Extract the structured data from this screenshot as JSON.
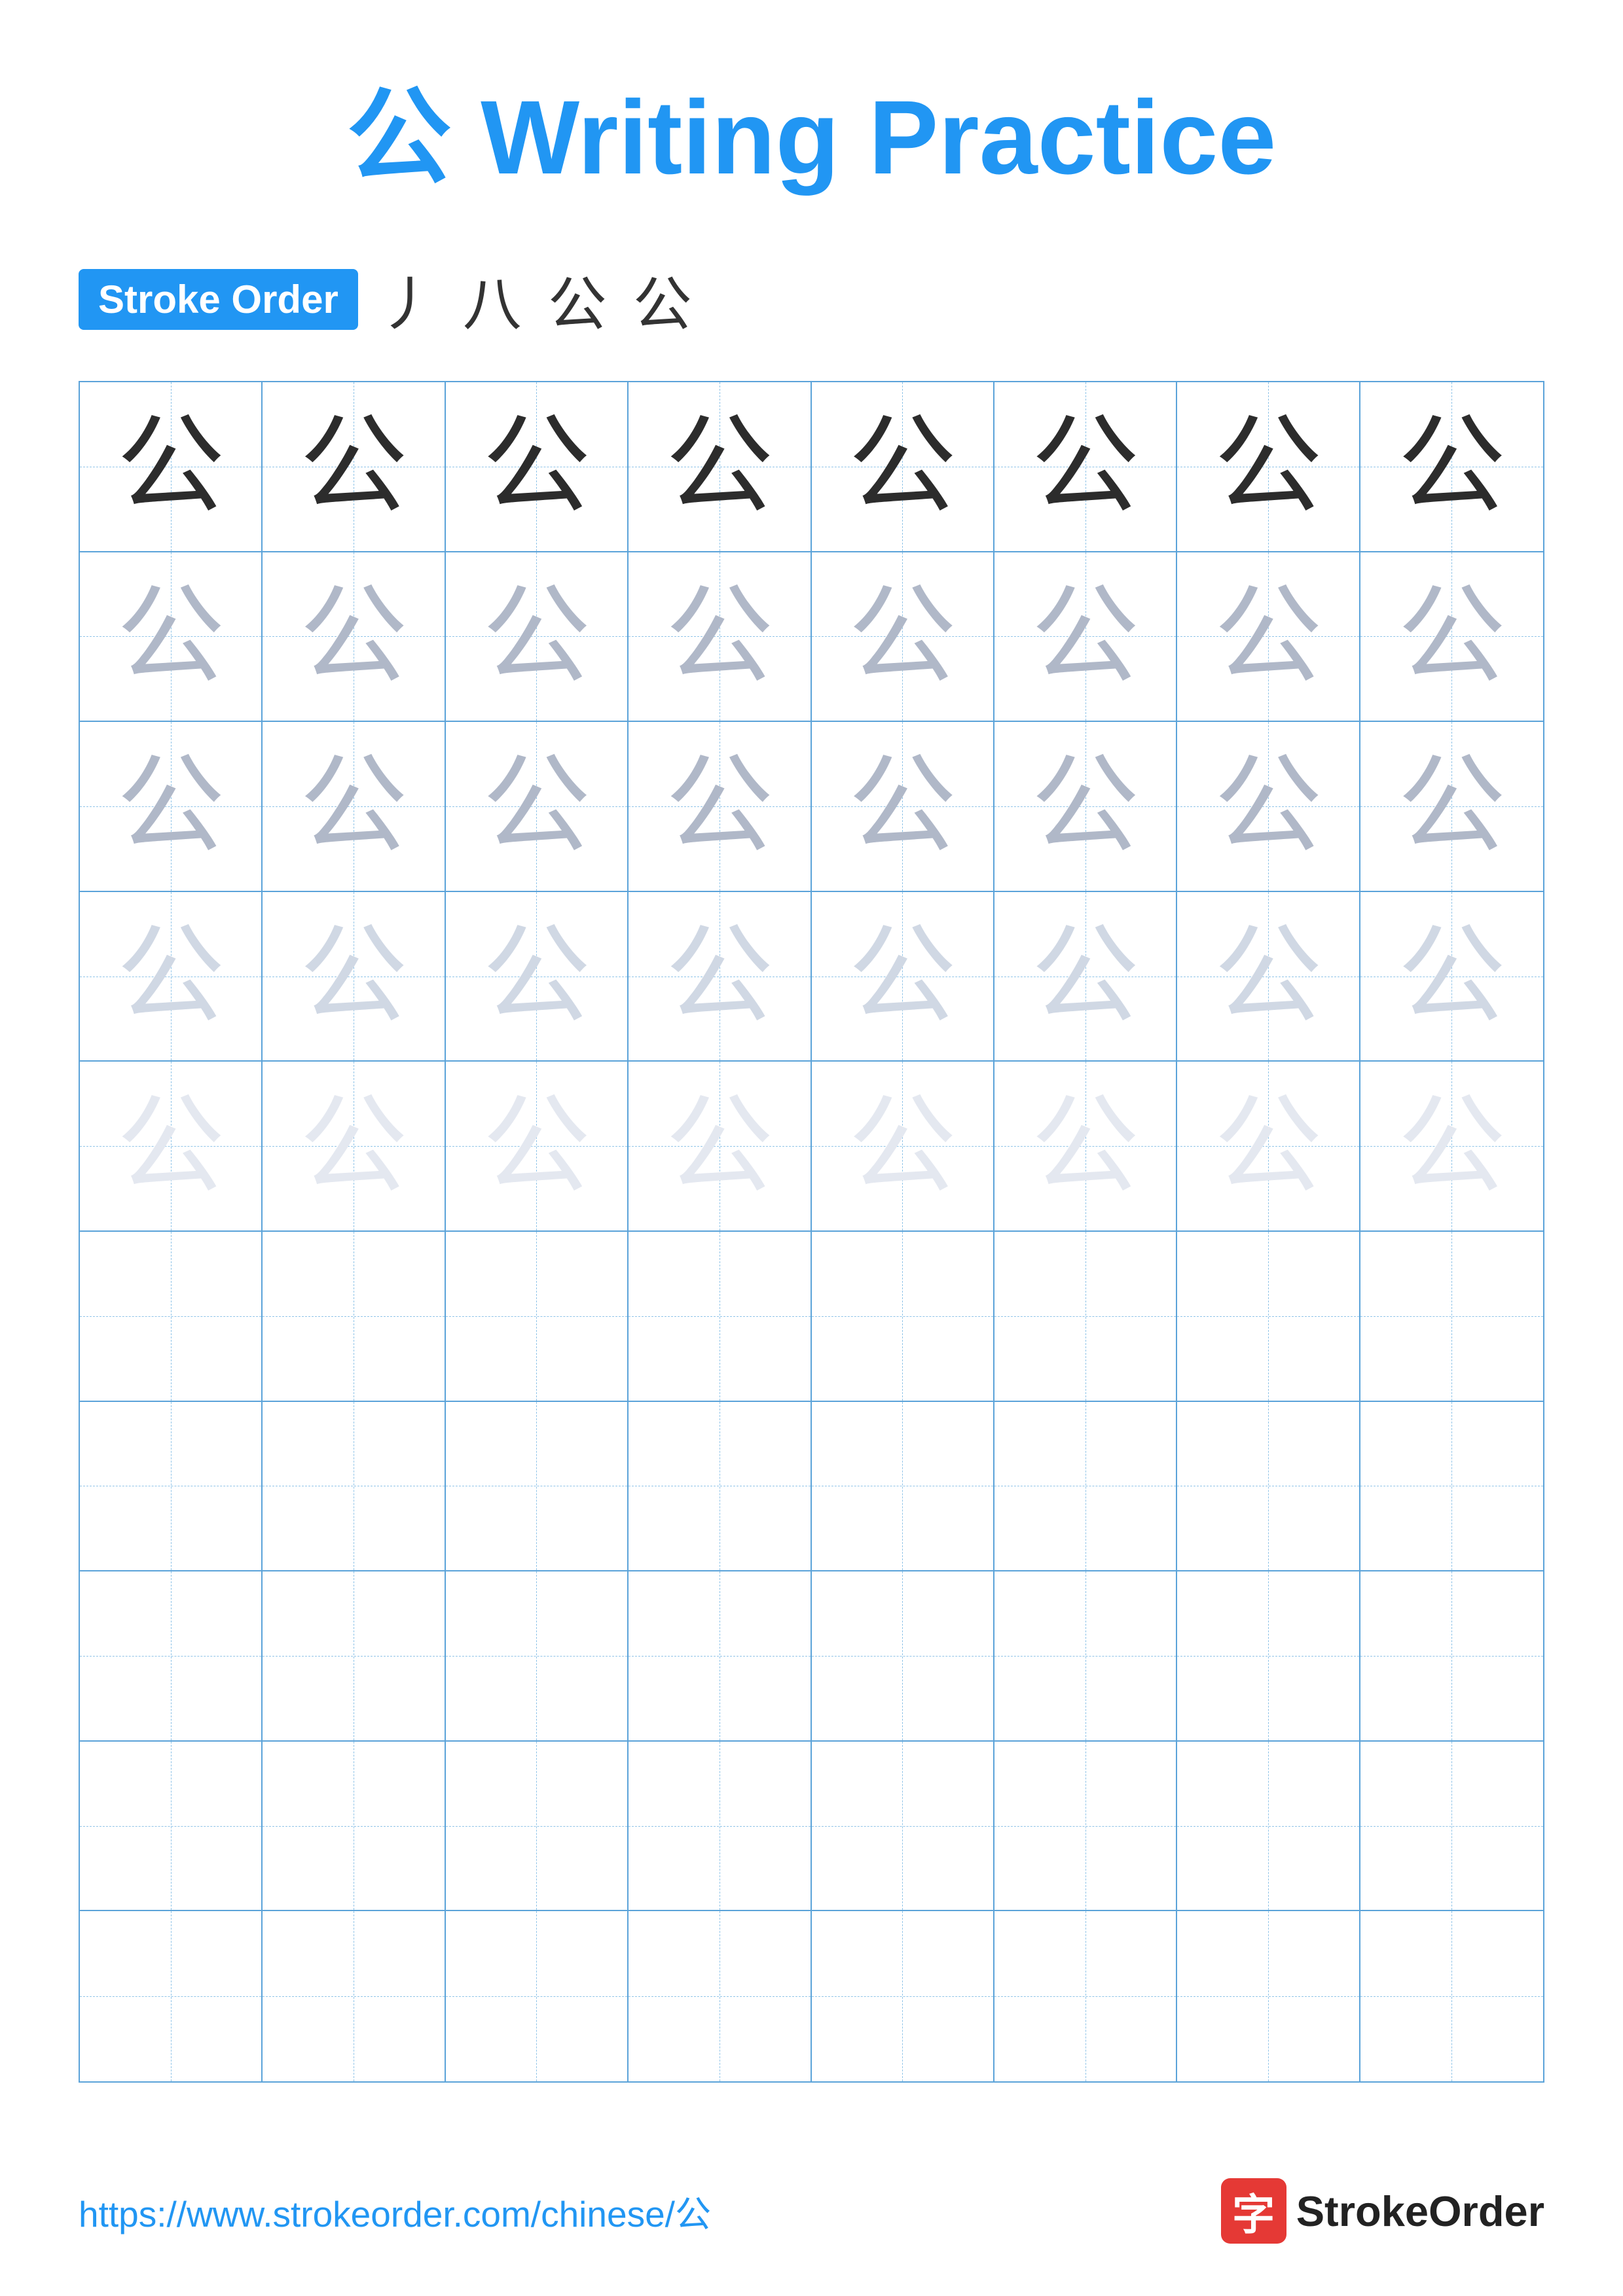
{
  "title": {
    "char": "公",
    "label": "Writing Practice",
    "full": "公 Writing Practice"
  },
  "stroke_order": {
    "badge_label": "Stroke Order",
    "strokes": [
      "丿",
      "八",
      "公",
      "公"
    ]
  },
  "grid": {
    "rows": 10,
    "cols": 8,
    "character": "公",
    "filled_rows": 5,
    "opacity_pattern": [
      "dark",
      "medium",
      "medium",
      "light",
      "very-light"
    ]
  },
  "footer": {
    "url": "https://www.strokeorder.com/chinese/公",
    "brand_char": "字",
    "brand_name": "StrokeOrder"
  }
}
